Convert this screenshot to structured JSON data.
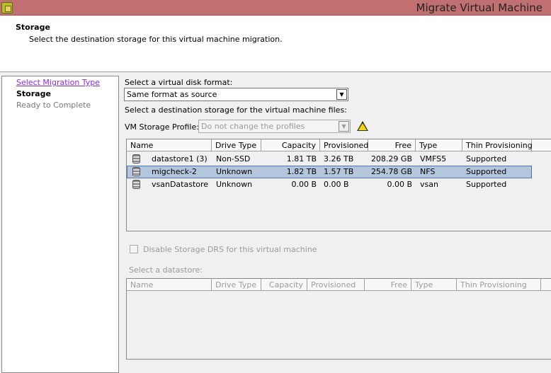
{
  "window": {
    "title": "Migrate Virtual Machine"
  },
  "header": {
    "title": "Storage",
    "subtitle": "Select the destination storage for this virtual machine migration."
  },
  "steps": [
    {
      "label": "Select Migration Type"
    },
    {
      "label": "Storage"
    },
    {
      "label": "Ready to Complete"
    }
  ],
  "disk_format": {
    "label": "Select a virtual disk format:",
    "value": "Same format as source"
  },
  "dest_label": "Select a destination storage for the virtual machine files:",
  "profile": {
    "label": "VM Storage Profile:",
    "value": "Do not change the profiles"
  },
  "columns": [
    "Name",
    "Drive Type",
    "Capacity",
    "Provisioned",
    "Free",
    "Type",
    "Thin Provisioning"
  ],
  "rows": [
    {
      "name": "datastore1 (3)",
      "drive": "Non-SSD",
      "capacity": "1.81 TB",
      "provisioned": "3.26 TB",
      "free": "208.29 GB",
      "type": "VMFS5",
      "thin": "Supported"
    },
    {
      "name": "migcheck-2",
      "drive": "Unknown",
      "capacity": "1.82 TB",
      "provisioned": "1.57 TB",
      "free": "254.78 GB",
      "type": "NFS",
      "thin": "Supported"
    },
    {
      "name": "vsanDatastore",
      "drive": "Unknown",
      "capacity": "0.00 B",
      "provisioned": "0.00 B",
      "free": "0.00 B",
      "type": "vsan",
      "thin": "Supported"
    }
  ],
  "drs_label": "Disable Storage DRS for this virtual machine",
  "select_ds_label": "Select a datastore:"
}
